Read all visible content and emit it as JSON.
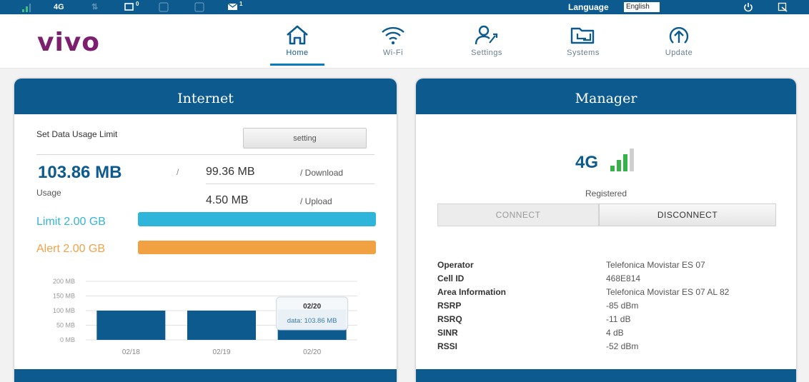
{
  "statusbar": {
    "network_type": "4G",
    "sms_count": "0",
    "mail_count": "1",
    "language_label": "Language",
    "language_value": "English"
  },
  "header": {
    "logo": "vivo",
    "nav": [
      {
        "label": "Home",
        "icon": "home-icon",
        "active": true
      },
      {
        "label": "Wi-Fi",
        "icon": "wifi-icon",
        "active": false
      },
      {
        "label": "Settings",
        "icon": "settings-icon",
        "active": false
      },
      {
        "label": "Systems",
        "icon": "systems-icon",
        "active": false
      },
      {
        "label": "Update",
        "icon": "update-icon",
        "active": false
      }
    ]
  },
  "internet": {
    "title": "Internet",
    "set_limit_label": "Set Data Usage Limit",
    "setting_button": "setting",
    "usage_value": "103.86 MB",
    "usage_label": "Usage",
    "slash": "/",
    "download_value": "99.36 MB",
    "download_label": "/ Download",
    "upload_value": "4.50 MB",
    "upload_label": "/ Upload",
    "limit_label": "Limit 2.00 GB",
    "alert_label": "Alert 2.00 GB",
    "colors": {
      "limit": "#2fb5d9",
      "alert": "#f2a142",
      "accent": "#0d5b8e"
    }
  },
  "chart_data": {
    "type": "bar",
    "categories": [
      "02/18",
      "02/19",
      "02/20"
    ],
    "values": [
      100,
      100,
      103.86
    ],
    "y_tick_labels": [
      "0 MB",
      "50 MB",
      "100 MB",
      "150 MB",
      "200 MB"
    ],
    "ylim": [
      0,
      200
    ],
    "tooltip": {
      "title": "02/20",
      "text": "data: 103.86 MB"
    },
    "bar_color": "#0d5b8e"
  },
  "manager": {
    "title": "Manager",
    "network": "4G",
    "signal_bars": 3,
    "signal_max": 4,
    "status": "Registered",
    "connect_button": "CONNECT",
    "disconnect_button": "DISCONNECT",
    "info": [
      {
        "key": "Operator",
        "value": "Telefonica Movistar ES 07"
      },
      {
        "key": "Cell ID",
        "value": "468E814"
      },
      {
        "key": "Area Information",
        "value": "Telefonica Movistar ES 07 AL 82"
      },
      {
        "key": "RSRP",
        "value": "-85 dBm"
      },
      {
        "key": "RSRQ",
        "value": "-11 dB"
      },
      {
        "key": "SINR",
        "value": "4 dB"
      },
      {
        "key": "RSSI",
        "value": "-52 dBm"
      }
    ]
  }
}
